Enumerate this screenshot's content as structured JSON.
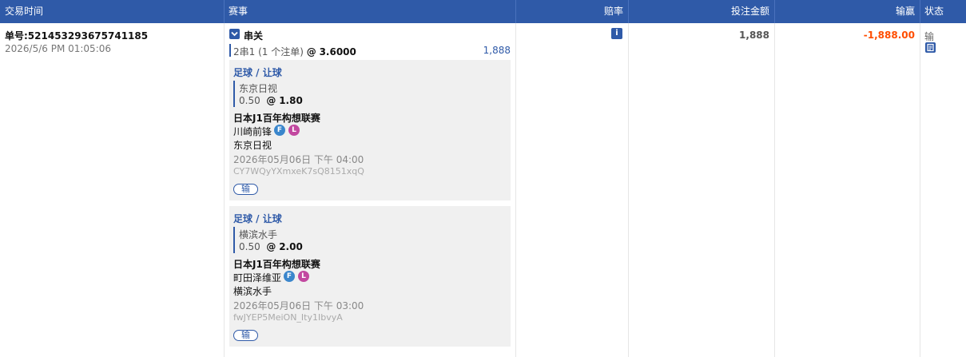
{
  "header": {
    "time": "交易时间",
    "event": "赛事",
    "odds": "赔率",
    "stake": "投注金额",
    "winloss": "输赢",
    "status": "状态"
  },
  "order": {
    "id": "单号:521453293675741185",
    "time": "2026/5/6 PM 01:05:06",
    "parlay_title": "串关",
    "summary_prefix": "2串1 (1 个注单)",
    "summary_at": "@",
    "summary_odds": "3.6000",
    "summary_stake": "1,888",
    "stake": "1,888",
    "winloss": "-1,888.00",
    "status": "输",
    "colors": {
      "accent": "#2f5aa8",
      "loss": "#ff4d00"
    }
  },
  "legs": [
    {
      "sport": "足球 / 让球",
      "selection": "东京日视",
      "handicap": "0.50",
      "at": "@",
      "odds": "1.80",
      "league": "日本J1百年构想联赛",
      "home": "川崎前锋",
      "tag_f": "F",
      "tag_l": "L",
      "away": "东京日视",
      "datetime": "2026年05月06日 下午 04:00",
      "ref": "CY7WQyYXmxeK7sQ8151xqQ",
      "result": "输"
    },
    {
      "sport": "足球 / 让球",
      "selection": "横滨水手",
      "handicap": "0.50",
      "at": "@",
      "odds": "2.00",
      "league": "日本J1百年构想联赛",
      "home": "町田泽维亚",
      "tag_f": "F",
      "tag_l": "L",
      "away": "横滨水手",
      "datetime": "2026年05月06日 下午 03:00",
      "ref": "fwJYEP5MeiON_Ity1IbvyA",
      "result": "输"
    }
  ],
  "icons": {
    "collapse": "chevron-down-icon",
    "odds_info": "info-icon",
    "status_detail": "document-icon"
  }
}
